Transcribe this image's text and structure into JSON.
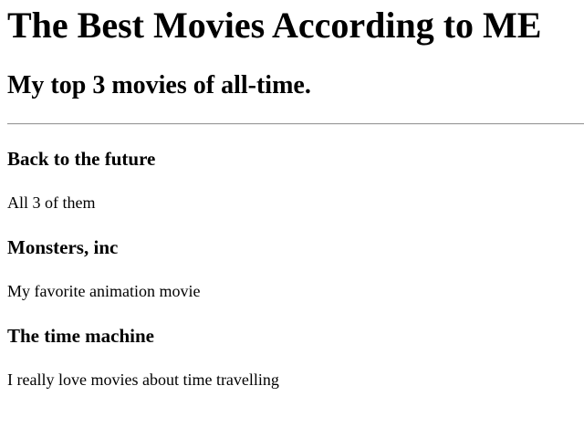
{
  "header": {
    "title": "The Best Movies According to ME",
    "subtitle": "My top 3 movies of all-time."
  },
  "movies": [
    {
      "title": "Back to the future",
      "description": "All 3 of them"
    },
    {
      "title": "Monsters, inc",
      "description": "My favorite animation movie"
    },
    {
      "title": "The time machine",
      "description": "I really love movies about time travelling"
    }
  ],
  "colors": {
    "text": "#000000",
    "background": "#ffffff",
    "divider": "#9a9a9a"
  }
}
